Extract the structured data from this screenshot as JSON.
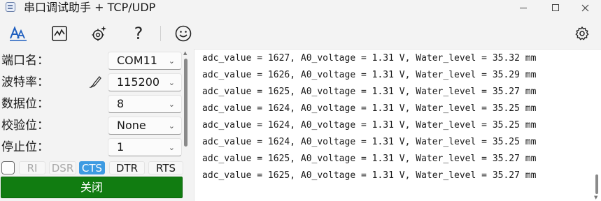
{
  "window": {
    "title": "串口调试助手 + TCP/UDP",
    "app_icon": "serial-port-icon",
    "controls": [
      "minimize-icon",
      "maximize-icon",
      "close-icon"
    ]
  },
  "toolbar": {
    "icons": [
      "font-icon",
      "waveform-icon",
      "magic-settings-icon",
      "help-icon",
      "smiley-icon",
      "gear-icon"
    ],
    "help_glyph": "?"
  },
  "settings": {
    "port": {
      "label": "端口名：",
      "value": "COM11"
    },
    "baud": {
      "label": "波特率：",
      "value": "115200"
    },
    "databits": {
      "label": "数据位：",
      "value": "8"
    },
    "parity": {
      "label": "校验位：",
      "value": "None"
    },
    "stopbits": {
      "label": "停止位：",
      "value": "1"
    }
  },
  "signals": {
    "checked": false,
    "ri": "RI",
    "dsr": "DSR",
    "cts": "CTS",
    "dtr": "DTR",
    "rts": "RTS"
  },
  "close_button": "关闭",
  "log": {
    "lines": [
      "adc_value = 1627, A0_voltage = 1.31 V, Water_level = 35.32 mm",
      "adc_value = 1626, A0_voltage = 1.31 V, Water_level = 35.29 mm",
      "adc_value = 1625, A0_voltage = 1.31 V, Water_level = 35.27 mm",
      "adc_value = 1624, A0_voltage = 1.31 V, Water_level = 35.25 mm",
      "adc_value = 1624, A0_voltage = 1.31 V, Water_level = 35.25 mm",
      "adc_value = 1624, A0_voltage = 1.31 V, Water_level = 35.25 mm",
      "adc_value = 1625, A0_voltage = 1.31 V, Water_level = 35.27 mm",
      "adc_value = 1625, A0_voltage = 1.31 V, Water_level = 35.27 mm"
    ]
  },
  "colors": {
    "close_button_bg": "#117c11",
    "cts_active": "#3d9be2",
    "toolbar_icon": "#1f5fbf"
  }
}
